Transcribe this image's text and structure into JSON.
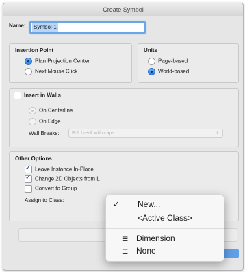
{
  "dialog": {
    "title": "Create Symbol",
    "name_label": "Name:",
    "name_value": "Symbol-1"
  },
  "insertion_point": {
    "heading": "Insertion Point",
    "options": [
      "Plan Projection Center",
      "Next Mouse Click"
    ],
    "selected": 0
  },
  "units": {
    "heading": "Units",
    "options": [
      "Page-based",
      "World-based"
    ],
    "selected": 1
  },
  "insert_in_walls": {
    "label": "Insert in Walls",
    "checked": false,
    "options": [
      "On Centerline",
      "On Edge"
    ],
    "wall_breaks_label": "Wall Breaks:",
    "wall_breaks_value": "Full break with caps"
  },
  "other_options": {
    "heading": "Other Options",
    "checkboxes": [
      {
        "label": "Leave Instance In-Place",
        "checked": true
      },
      {
        "label": "Change 2D Objects from L",
        "checked": true
      },
      {
        "label": "Convert to Group",
        "checked": false
      }
    ],
    "assign_label": "Assign to Class:"
  },
  "class_menu": {
    "items": [
      {
        "label": "New...",
        "checked": true,
        "icon": ""
      },
      {
        "label": "<Active Class>",
        "checked": false,
        "icon": ""
      },
      {
        "label": "Dimension",
        "checked": false,
        "icon": "class-icon"
      },
      {
        "label": "None",
        "checked": false,
        "icon": "class-icon"
      }
    ]
  },
  "colors": {
    "accent": "#2d7fe0",
    "focus": "#6aa7e6"
  }
}
